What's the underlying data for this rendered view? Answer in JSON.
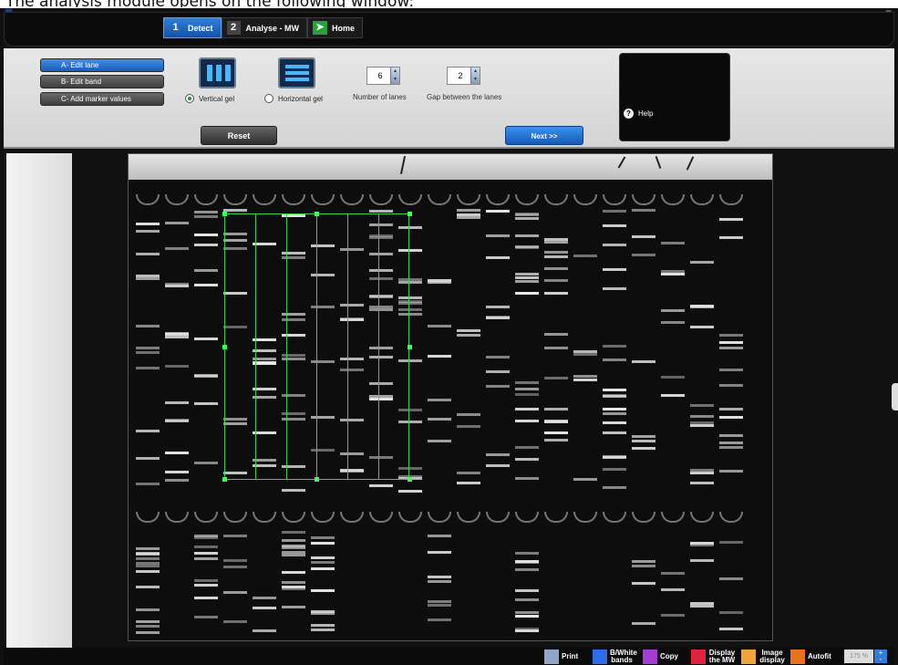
{
  "caption": "The analysis module opens on the following window:",
  "window": {
    "controls": "_ 🗗"
  },
  "tabs": [
    {
      "num": "1",
      "label": "Detect"
    },
    {
      "num": "2",
      "label": "Analyse - MW"
    },
    {
      "num": "",
      "label": "Home"
    }
  ],
  "lane_buttons": [
    "A- Edit lane",
    "B- Edit band",
    "C- Add marker values"
  ],
  "gel_type": {
    "vertical_label": "Vertical gel",
    "horizontal_label": "Horizontal gel",
    "selected": "vertical"
  },
  "lanes": {
    "number_value": "6",
    "number_label": "Number of lanes",
    "gap_value": "2",
    "gap_label": "Gap between the lanes"
  },
  "buttons": {
    "reset": "Reset",
    "next": "Next  >>"
  },
  "help": {
    "label": "Help"
  },
  "toolbar": [
    {
      "label": "Print",
      "color": "#8fa6c9"
    },
    {
      "label": "B/White bands",
      "color": "#2c6ee6"
    },
    {
      "label": "Copy",
      "color": "#a63bd6"
    },
    {
      "label": "Display the MW",
      "color": "#e0233a"
    },
    {
      "label": "Image display",
      "color": "#f0a33a"
    },
    {
      "label": "Autofit",
      "color": "#e8731e"
    }
  ],
  "zoom": "175 %",
  "colors": {
    "accent": "#1f6ad0",
    "overlay": "#37d14a"
  }
}
